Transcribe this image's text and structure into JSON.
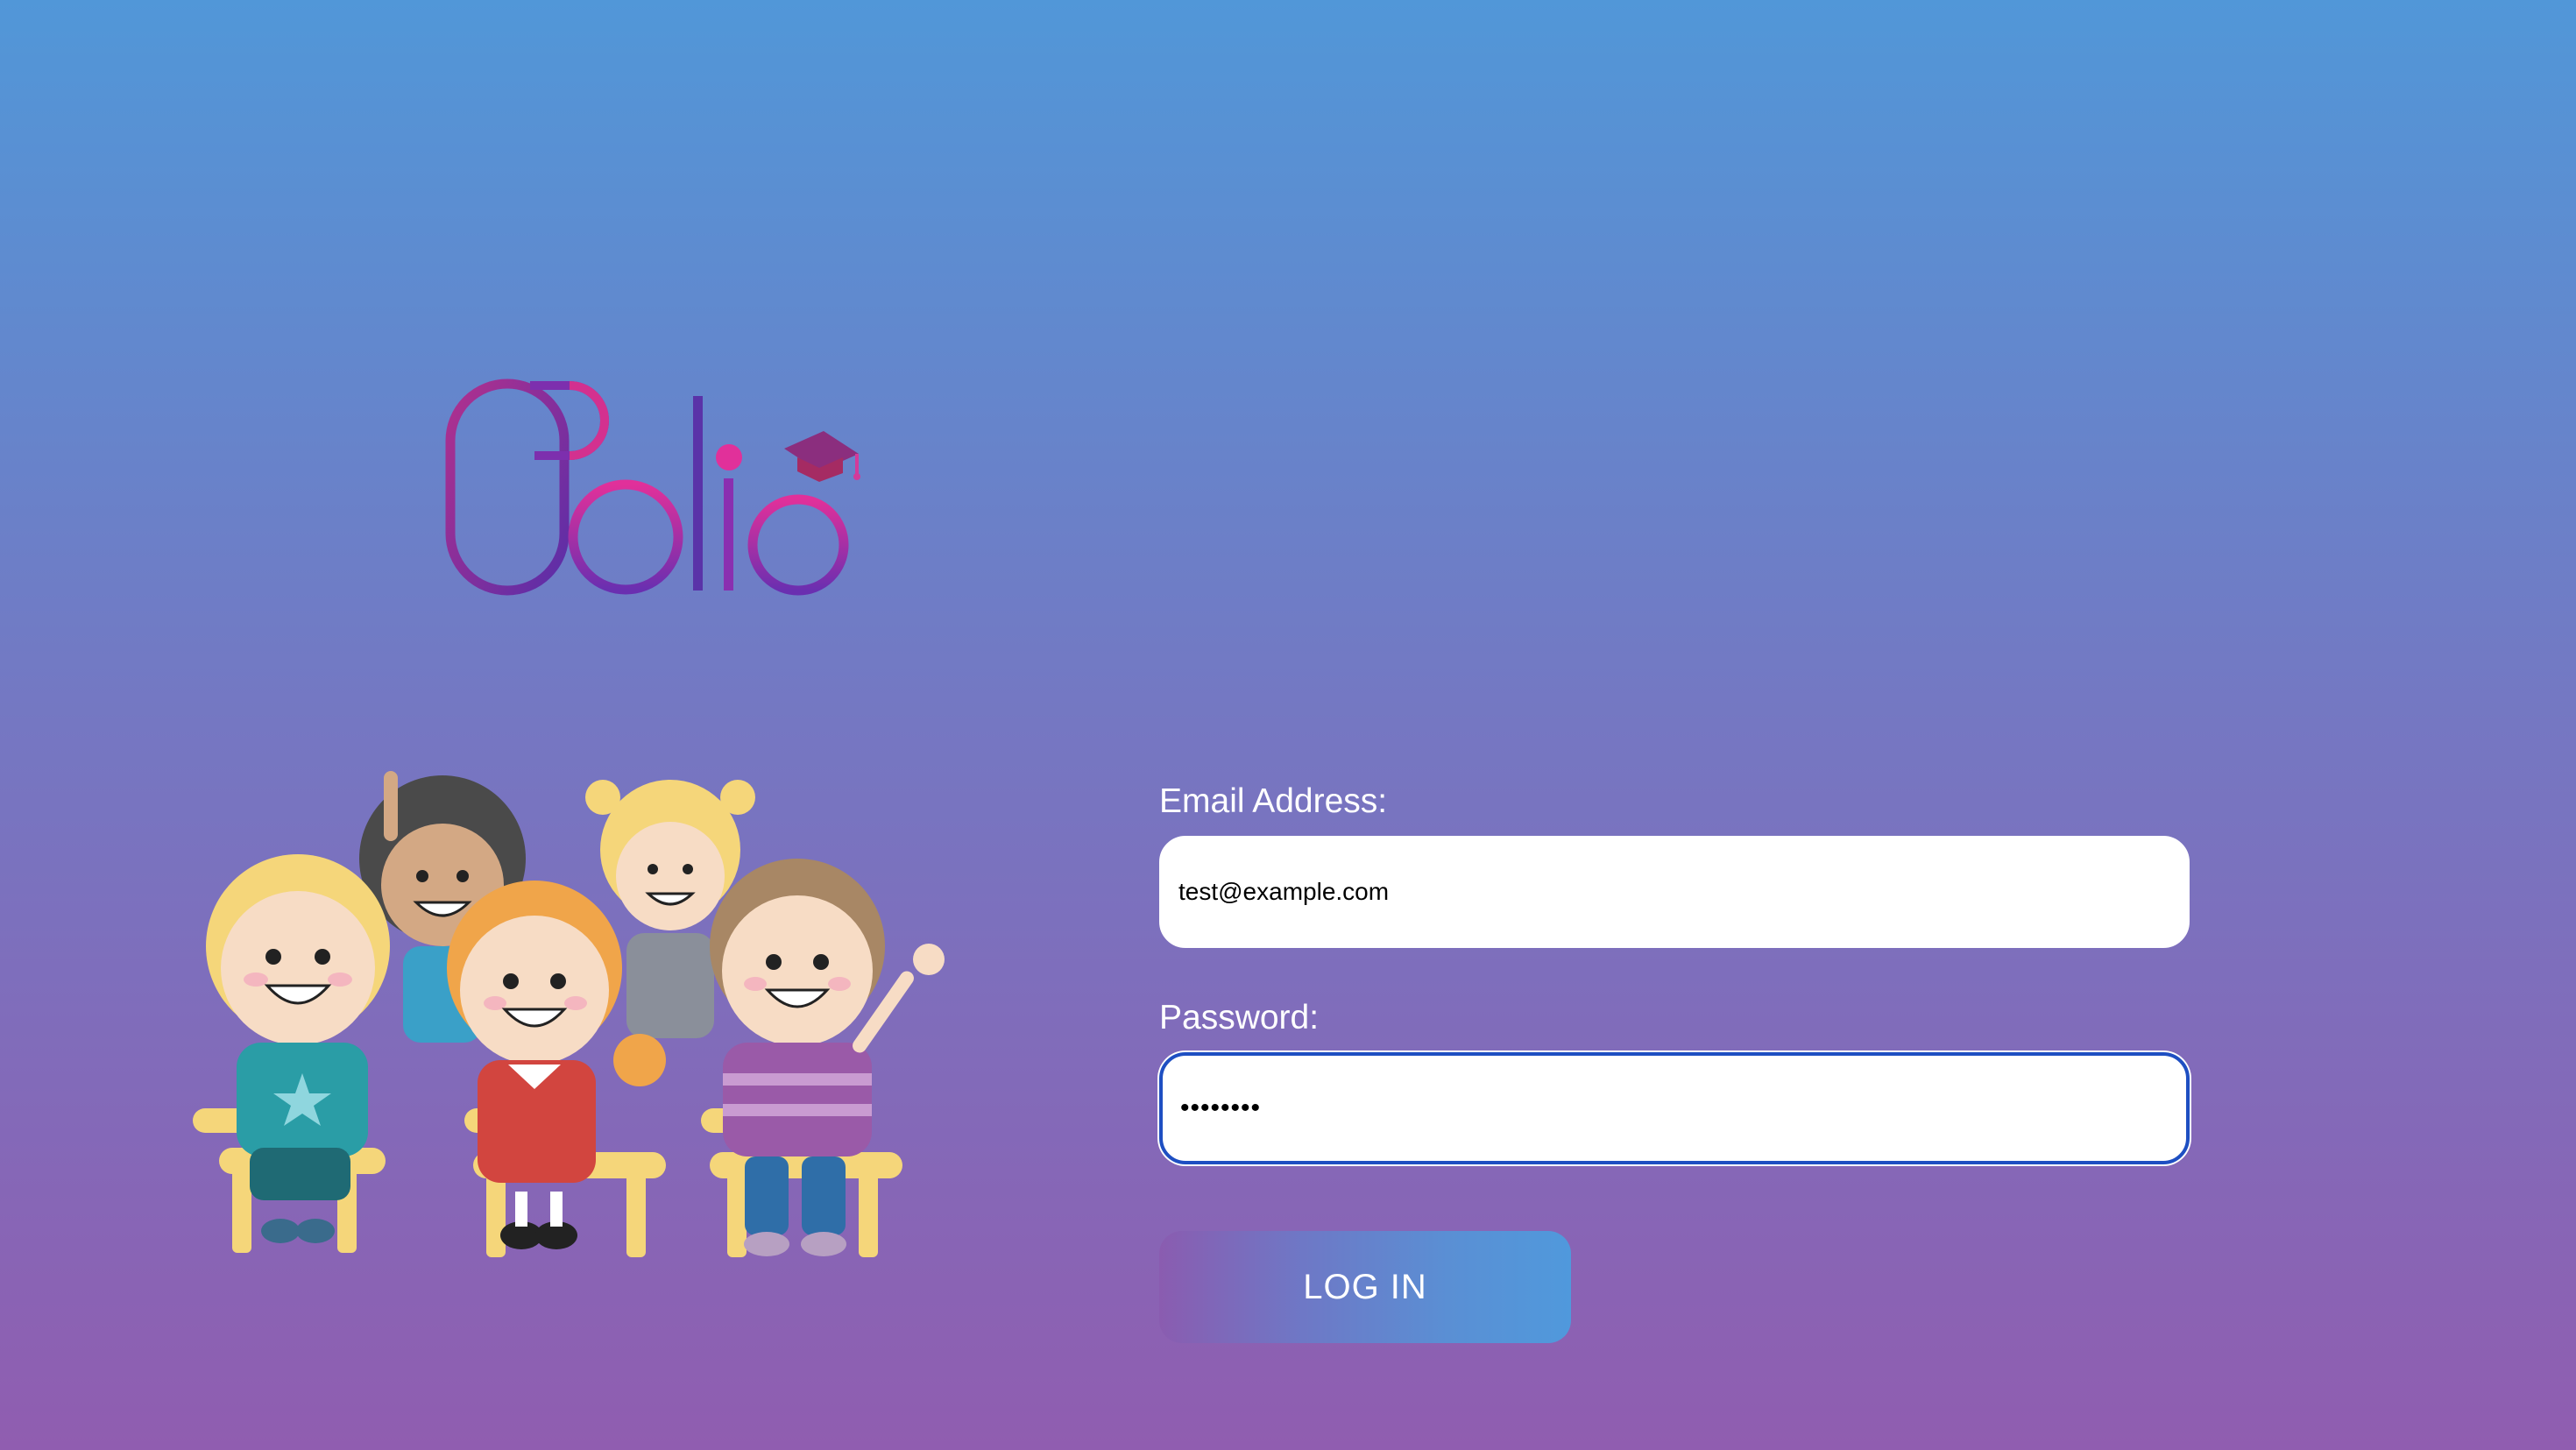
{
  "app": {
    "logo_text": "Bolio"
  },
  "form": {
    "email_label": "Email Address:",
    "email_value": "test@example.com",
    "password_label": "Password:",
    "password_value": "••••••••",
    "login_label": "LOG IN"
  },
  "colors": {
    "bg_top": "#5197d8",
    "bg_bottom": "#905db0",
    "logo_purple": "#6a2fb0",
    "logo_pink": "#e0309a",
    "focus_border": "#1e4fc2"
  }
}
